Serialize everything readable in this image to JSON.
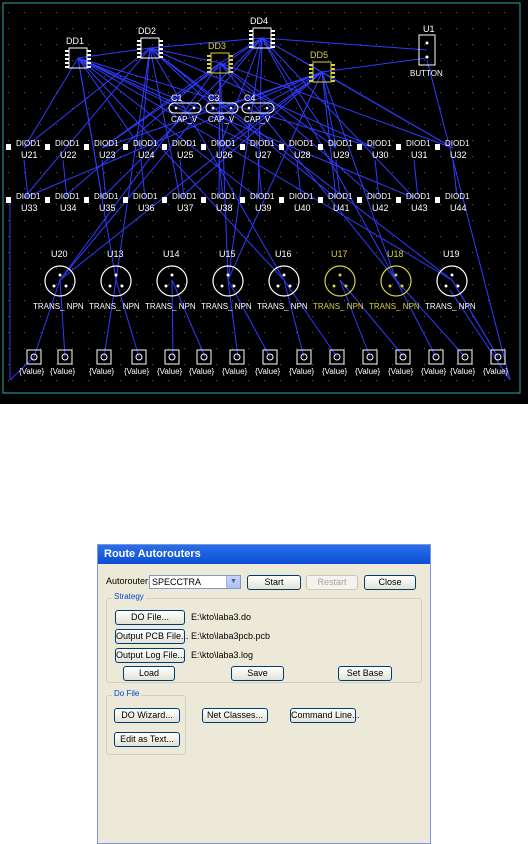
{
  "pcb": {
    "ics": [
      {
        "ref": "DD1",
        "highlight": false
      },
      {
        "ref": "DD2",
        "highlight": false
      },
      {
        "ref": "DD3",
        "highlight": true
      },
      {
        "ref": "DD4",
        "highlight": false
      },
      {
        "ref": "DD5",
        "highlight": true
      }
    ],
    "button": {
      "ref": "U1",
      "value": "BUTTON"
    },
    "caps": [
      {
        "ref": "C1",
        "value": "CAP_V"
      },
      {
        "ref": "C3",
        "value": "CAP_V"
      },
      {
        "ref": "C4",
        "value": "CAP_V"
      }
    ],
    "diodes_row1": [
      {
        "value": "DIOD1",
        "ref": "U21"
      },
      {
        "value": "DIOD1",
        "ref": "U22"
      },
      {
        "value": "DIOD1",
        "ref": "U23"
      },
      {
        "value": "DIOD1",
        "ref": "U24"
      },
      {
        "value": "DIOD1",
        "ref": "U25"
      },
      {
        "value": "DIOD1",
        "ref": "U26"
      },
      {
        "value": "DIOD1",
        "ref": "U27"
      },
      {
        "value": "DIOD1",
        "ref": "U28"
      },
      {
        "value": "DIOD1",
        "ref": "U29"
      },
      {
        "value": "DIOD1",
        "ref": "U30"
      },
      {
        "value": "DIOD1",
        "ref": "U31"
      },
      {
        "value": "DIOD1",
        "ref": "U32"
      }
    ],
    "diodes_row2": [
      {
        "value": "DIOD1",
        "ref": "U33"
      },
      {
        "value": "DIOD1",
        "ref": "U34"
      },
      {
        "value": "DIOD1",
        "ref": "U35"
      },
      {
        "value": "DIOD1",
        "ref": "U36"
      },
      {
        "value": "DIOD1",
        "ref": "U37"
      },
      {
        "value": "DIOD1",
        "ref": "U38"
      },
      {
        "value": "DIOD1",
        "ref": "U39"
      },
      {
        "value": "DIOD1",
        "ref": "U40"
      },
      {
        "value": "DIOD1",
        "ref": "U41"
      },
      {
        "value": "DIOD1",
        "ref": "U42"
      },
      {
        "value": "DIOD1",
        "ref": "U43"
      },
      {
        "value": "DIOD1",
        "ref": "U44"
      }
    ],
    "transistors": [
      {
        "ref": "U20",
        "value": "TRANS_ NPN",
        "highlight": false
      },
      {
        "ref": "U13",
        "value": "TRANS_ NPN",
        "highlight": false
      },
      {
        "ref": "U14",
        "value": "TRANS_ NPN",
        "highlight": false
      },
      {
        "ref": "U15",
        "value": "TRANS_ NPN",
        "highlight": false
      },
      {
        "ref": "U16",
        "value": "TRANS_ NPN",
        "highlight": false
      },
      {
        "ref": "U17",
        "value": "TRANS_ NPN",
        "highlight": true
      },
      {
        "ref": "U18",
        "value": "TRANS_ NPN",
        "highlight": true
      },
      {
        "ref": "U19",
        "value": "TRANS_ NPN",
        "highlight": false
      }
    ],
    "value_pads": [
      "{Value}",
      "{Value}",
      "{Value}",
      "{Value}",
      "{Value}",
      "{Value}",
      "{Value}",
      "{Value}",
      "{Value}",
      "{Value}",
      "{Value}",
      "{Value}",
      "{Value}",
      "{Value}",
      "{Value}",
      "{Value}"
    ],
    "colors": {
      "background": "#000000",
      "traces": "#2f3bff",
      "highlight": "#d8d23a",
      "outline": "#2aa7a0"
    }
  },
  "dialog": {
    "title": "Route Autorouters",
    "autorouter_label": "Autorouter:",
    "autorouter_value": "SPECCTRA",
    "start": "Start",
    "restart": "Restart",
    "close": "Close",
    "strategy_title": "Strategy",
    "do_file_btn": "DO File...",
    "do_file_path": "E:\\kto\\laba3.do",
    "output_pcb_btn": "Output PCB File...",
    "output_pcb_path": "E:\\kto\\laba3pcb.pcb",
    "output_log_btn": "Output Log File...",
    "output_log_path": "E:\\kto\\laba3.log",
    "load": "Load",
    "save": "Save",
    "set_base": "Set Base",
    "dofile_title": "Do File",
    "do_wizard": "DO Wizard...",
    "edit_as_text": "Edit as Text...",
    "net_classes": "Net Classes...",
    "command_line": "Command Line..."
  }
}
